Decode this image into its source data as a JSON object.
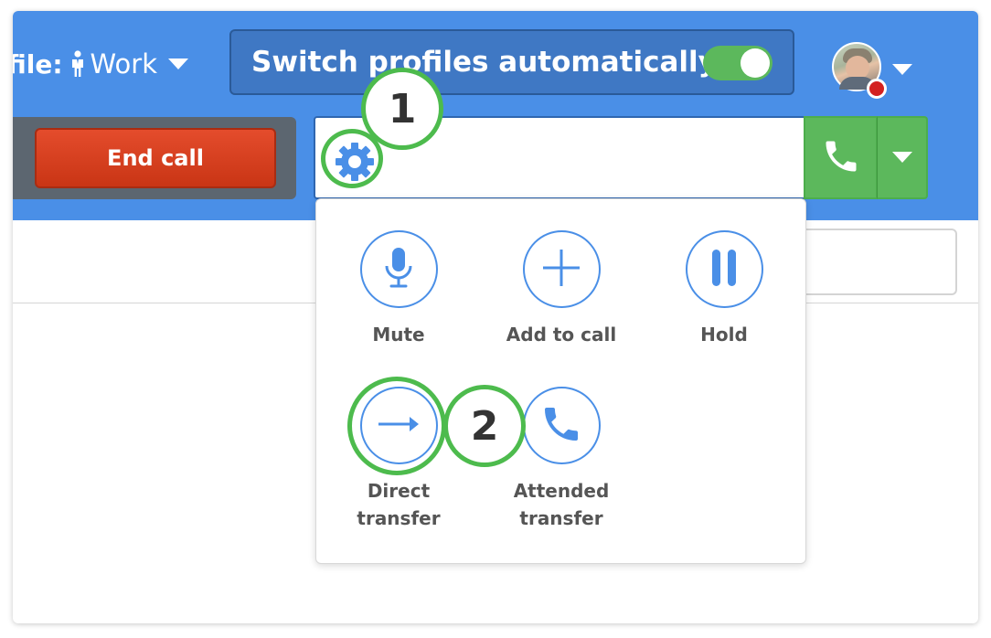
{
  "header": {
    "profile_label": "file:",
    "profile_name": "Work",
    "switch_label": "Switch profiles automatically",
    "switch_on": true
  },
  "call": {
    "end_call_label": "End call"
  },
  "dial": {
    "value": ""
  },
  "menu": {
    "actions": [
      {
        "label": "Mute",
        "icon": "microphone-icon"
      },
      {
        "label": "Add to call",
        "icon": "plus-icon"
      },
      {
        "label": "Hold",
        "icon": "pause-icon"
      },
      {
        "label": "Direct\ntransfer",
        "icon": "arrow-right-icon"
      },
      {
        "label": "Attended\ntransfer",
        "icon": "phone-icon"
      }
    ]
  },
  "annotations": {
    "step1": "1",
    "step2": "2"
  },
  "colors": {
    "header_blue": "#4a8fe7",
    "switch_box": "#3f78c4",
    "green": "#5cb85c",
    "end_call_red": "#d9411f",
    "highlight_green": "#4dbb4d",
    "status_red": "#d32020"
  }
}
